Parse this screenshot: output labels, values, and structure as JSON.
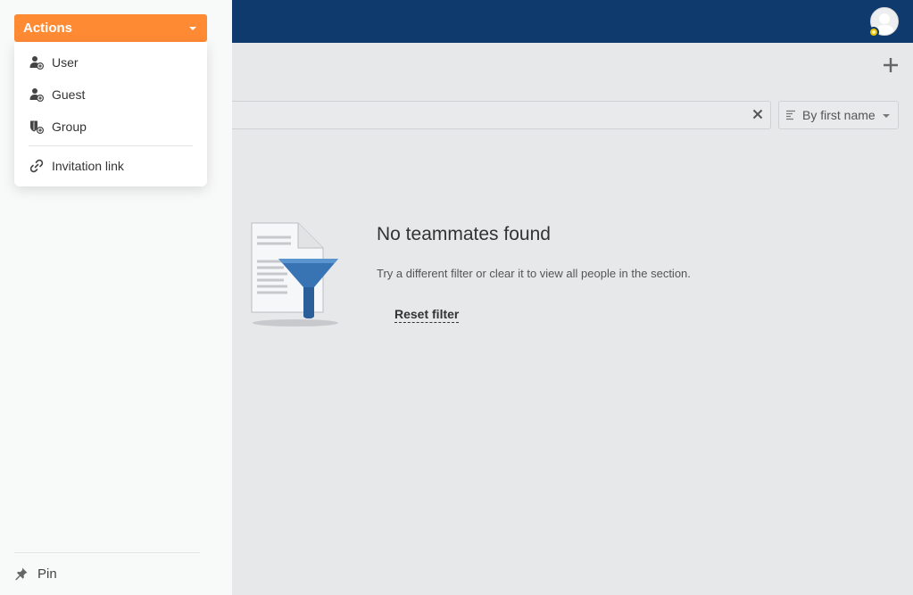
{
  "sidebar": {
    "actions_label": "Actions",
    "menu": [
      {
        "label": "User",
        "icon": "add-user-icon"
      },
      {
        "label": "Guest",
        "icon": "add-guest-icon"
      },
      {
        "label": "Group",
        "icon": "add-group-icon"
      },
      {
        "label": "Invitation link",
        "icon": "link-icon"
      }
    ],
    "pin_label": "Pin"
  },
  "header": {
    "avatar_icon": "user-avatar-icon",
    "brand_color": "#0f3a6d"
  },
  "toolbar": {
    "add_icon": "plus-icon",
    "search_placeholder": "",
    "sort_label": "By first name"
  },
  "empty_state": {
    "title": "No teammates found",
    "description": "Try a different filter or clear it to view all people in the section.",
    "reset_label": "Reset filter"
  },
  "colors": {
    "accent": "#ff8a34",
    "header": "#0f3a6d",
    "badge": "#e7c200"
  }
}
